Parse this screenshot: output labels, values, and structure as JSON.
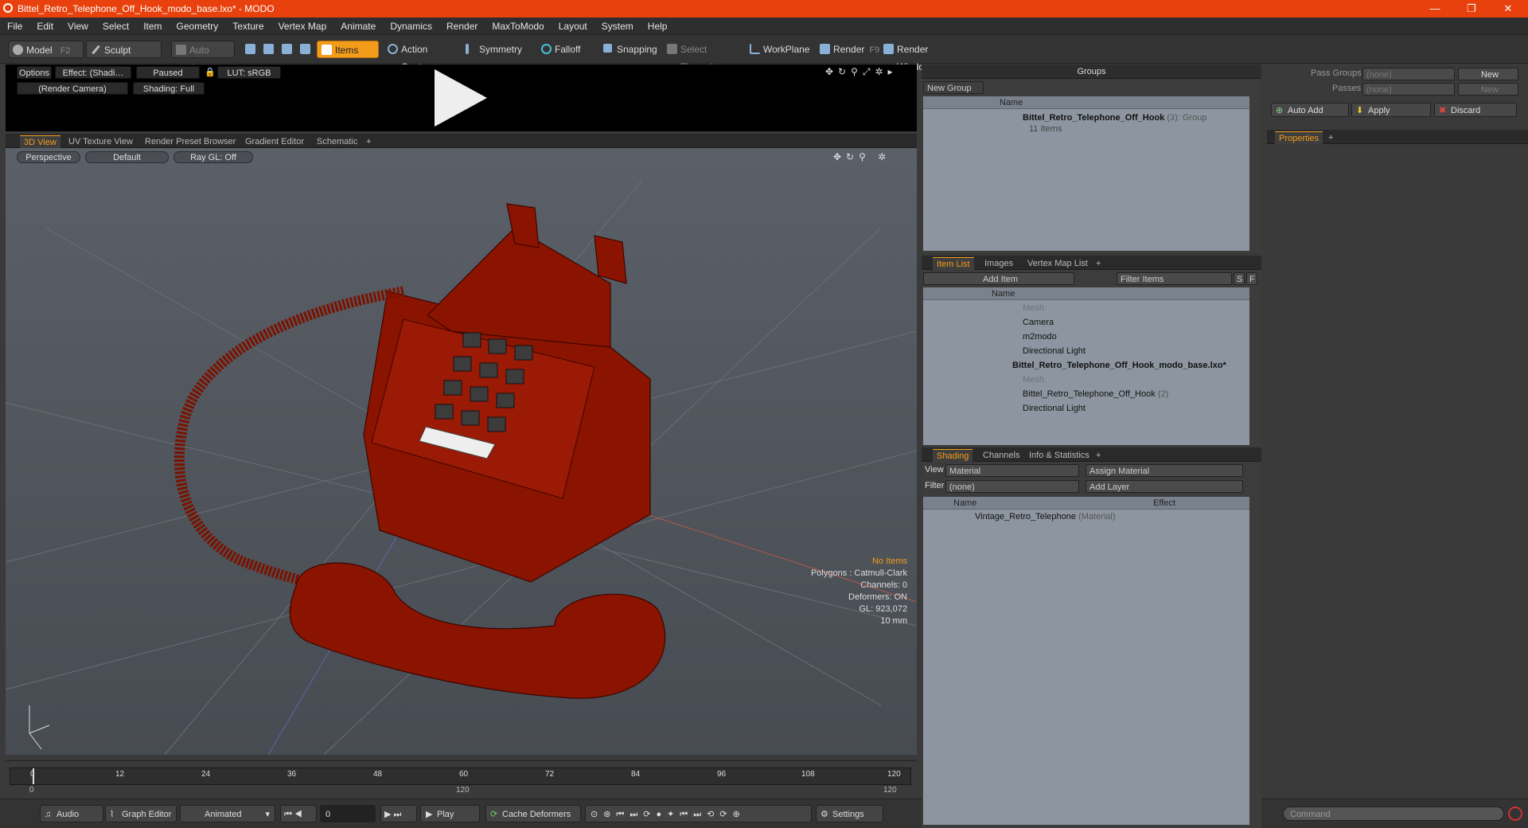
{
  "window": {
    "title": "Bittel_Retro_Telephone_Off_Hook_modo_base.lxo* - MODO",
    "minimize": "—",
    "maximize": "❐",
    "close": "✕"
  },
  "menu": [
    "File",
    "Edit",
    "View",
    "Select",
    "Item",
    "Geometry",
    "Texture",
    "Vertex Map",
    "Animate",
    "Dynamics",
    "Render",
    "MaxToModo",
    "Layout",
    "System",
    "Help"
  ],
  "toolbar": {
    "model": "Model",
    "model_key": "F2",
    "sculpt": "Sculpt",
    "auto_select": "Auto Select",
    "items": "Items",
    "action_center": "Action Center",
    "symmetry": "Symmetry",
    "falloff": "Falloff",
    "snapping": "Snapping",
    "select_through": "Select Through",
    "workplane": "WorkPlane",
    "render": "Render",
    "render_key": "F9",
    "render_window": "Render Window"
  },
  "preview": {
    "options": "Options",
    "effect": "Effect: (Shadi…",
    "paused": "Paused",
    "lut": "LUT: sRGB",
    "camera": "(Render Camera)",
    "shading": "Shading: Full"
  },
  "viewport_tabs": [
    "3D View",
    "UV Texture View",
    "Render Preset Browser",
    "Gradient Editor",
    "Schematic",
    "+"
  ],
  "viewport": {
    "perspective": "Perspective",
    "default": "Default",
    "raygl": "Ray GL: Off",
    "stats": {
      "no_items": "No Items",
      "polygons": "Polygons : Catmull-Clark",
      "channels": "Channels: 0",
      "deformers": "Deformers: ON",
      "gl": "GL: 923,072",
      "scale": "10 mm"
    }
  },
  "timeline": {
    "ticks": [
      "0",
      "12",
      "24",
      "36",
      "48",
      "60",
      "72",
      "84",
      "96",
      "108",
      "120"
    ],
    "start": "0",
    "mid": "120",
    "end": "120"
  },
  "bottom": {
    "audio": "Audio",
    "graph_editor": "Graph Editor",
    "animated": "Animated",
    "frame": "0",
    "play": "Play",
    "cache": "Cache Deformers",
    "settings": "Settings"
  },
  "groups": {
    "header": "Groups",
    "new_group": "New Group",
    "col_name": "Name",
    "item_name": "Bittel_Retro_Telephone_Off_Hook",
    "item_count": "(3)",
    "item_type": ": Group",
    "item_sub": "11 Items"
  },
  "itemlist": {
    "tabs": [
      "Item List",
      "Images",
      "Vertex Map List",
      "+"
    ],
    "add_item": "Add Item",
    "filter": "Filter Items",
    "s": "S",
    "f": "F",
    "col_name": "Name",
    "rows": [
      "Mesh",
      "Camera",
      "m2modo",
      "Directional Light",
      "Bittel_Retro_Telephone_Off_Hook_modo_base.lxo*",
      "Mesh",
      "Bittel_Retro_Telephone_Off_Hook",
      "Directional Light"
    ],
    "row7_count": "(2)"
  },
  "shading": {
    "tabs": [
      "Shading",
      "Channels",
      "Info & Statistics",
      "+"
    ],
    "view_label": "View",
    "view_value": "Material",
    "assign": "Assign Material",
    "filter_label": "Filter",
    "filter_value": "(none)",
    "add_layer": "Add Layer",
    "col_name": "Name",
    "col_effect": "Effect",
    "row": "Vintage_Retro_Telephone",
    "row_type": "(Material)"
  },
  "pass": {
    "pass_groups": "Pass Groups",
    "passes": "Passes",
    "none1": "(none)",
    "none2": "(none)",
    "new1": "New",
    "new2": "New",
    "auto_add": "Auto Add",
    "apply": "Apply",
    "discard": "Discard",
    "properties_tab": "Properties",
    "plus": "+",
    "command": "Command"
  }
}
